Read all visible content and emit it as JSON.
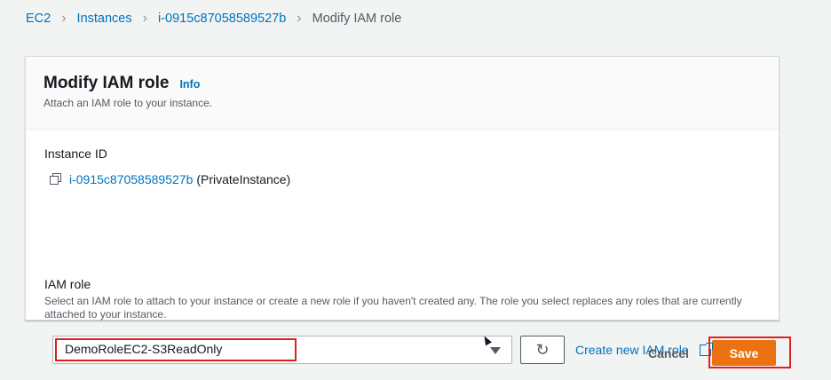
{
  "breadcrumb": {
    "items": [
      "EC2",
      "Instances",
      "i-0915c87058589527b"
    ],
    "current": "Modify IAM role"
  },
  "panel": {
    "title": "Modify IAM role",
    "info": "Info",
    "description": "Attach an IAM role to your instance."
  },
  "instance": {
    "label": "Instance ID",
    "id": "i-0915c87058589527b",
    "name": "(PrivateInstance)"
  },
  "iam_role": {
    "label": "IAM role",
    "description": "Select an IAM role to attach to your instance or create a new role if you haven't created any. The role you select replaces any roles that are currently attached to your instance.",
    "selected": "DemoRoleEC2-S3ReadOnly",
    "refresh_icon": "↻",
    "create_link": "Create new IAM role"
  },
  "actions": {
    "cancel": "Cancel",
    "save": "Save"
  },
  "colors": {
    "link": "#0073bb",
    "primary": "#ec7211",
    "highlight": "#e02020"
  },
  "icons": {
    "copy": "copy-icon",
    "dropdown": "caret-down-icon",
    "refresh": "refresh-icon",
    "external": "external-link-icon"
  }
}
